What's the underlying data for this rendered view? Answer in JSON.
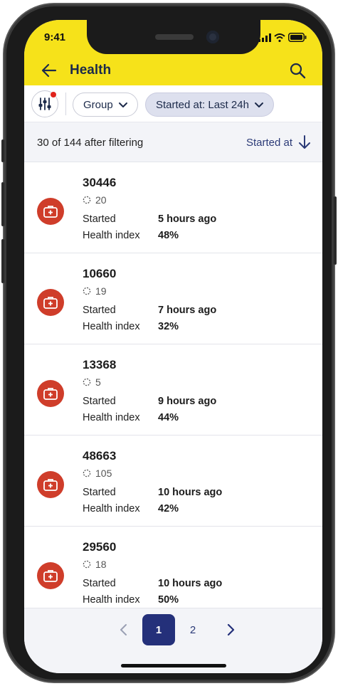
{
  "status_bar": {
    "time": "9:41"
  },
  "header": {
    "title": "Health"
  },
  "filters": {
    "chips": [
      {
        "label": "Group"
      },
      {
        "label": "Started at: Last 24h"
      }
    ]
  },
  "summary": {
    "count_text": "30 of 144 after filtering",
    "sort_label": "Started at"
  },
  "items": [
    {
      "id": "30446",
      "count": "20",
      "started_label": "Started",
      "started_value": "5 hours ago",
      "health_label": "Health index",
      "health_value": "48%"
    },
    {
      "id": "10660",
      "count": "19",
      "started_label": "Started",
      "started_value": "7 hours ago",
      "health_label": "Health index",
      "health_value": "32%"
    },
    {
      "id": "13368",
      "count": "5",
      "started_label": "Started",
      "started_value": "9 hours ago",
      "health_label": "Health index",
      "health_value": "44%"
    },
    {
      "id": "48663",
      "count": "105",
      "started_label": "Started",
      "started_value": "10 hours ago",
      "health_label": "Health index",
      "health_value": "42%"
    },
    {
      "id": "29560",
      "count": "18",
      "started_label": "Started",
      "started_value": "10 hours ago",
      "health_label": "Health index",
      "health_value": "50%"
    }
  ],
  "pagination": {
    "pages": [
      "1",
      "2"
    ],
    "current": "1"
  },
  "colors": {
    "appbar": "#f6e21a",
    "accent": "#24307a",
    "item_icon": "#cf3d2a",
    "filter_dot": "#e0231c"
  },
  "icons": [
    "back-arrow-icon",
    "search-icon",
    "filter-sliders-icon",
    "chevron-down-icon",
    "sort-down-arrow-icon",
    "medical-kit-icon",
    "dotted-circle-icon",
    "chevron-left-icon",
    "chevron-right-icon"
  ]
}
